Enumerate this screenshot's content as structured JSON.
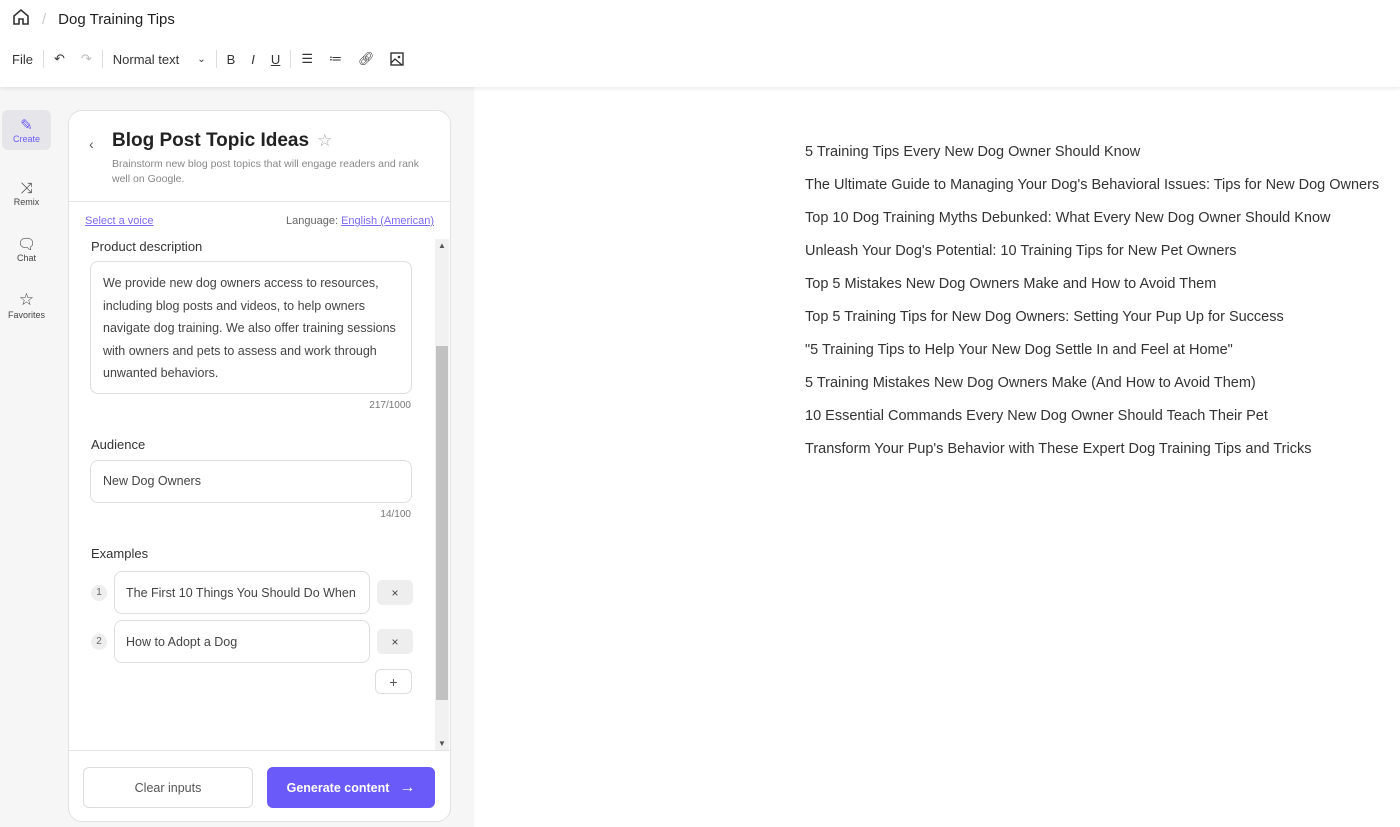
{
  "header": {
    "doc_title": "Dog Training Tips",
    "toolbar": {
      "file": "File",
      "style": "Normal text"
    }
  },
  "nav": [
    {
      "label": "Create"
    },
    {
      "label": "Remix"
    },
    {
      "label": "Chat"
    },
    {
      "label": "Favorites"
    }
  ],
  "panel": {
    "title": "Blog Post Topic Ideas",
    "subtitle": "Brainstorm new blog post topics that will engage readers and rank well on Google.",
    "select_voice": "Select a voice",
    "language_label": "Language:",
    "language": "English (American)",
    "product_label": "Product description",
    "product_value": "We provide new dog owners access to resources, including blog posts and videos, to help owners navigate dog training. We also offer training sessions with owners and pets to assess and work through unwanted behaviors.",
    "product_count": "217/1000",
    "audience_label": "Audience",
    "audience_value": "New Dog Owners",
    "audience_count": "14/100",
    "examples_label": "Examples",
    "examples": [
      {
        "n": "1",
        "value": "The First 10 Things You Should Do When"
      },
      {
        "n": "2",
        "value": "How to Adopt a Dog"
      }
    ],
    "remove": "×",
    "add": "+",
    "clear": "Clear inputs",
    "generate": "Generate content",
    "generate_arrow": "→"
  },
  "results": [
    "5 Training Tips Every New Dog Owner Should Know",
    "The Ultimate Guide to Managing Your Dog's Behavioral Issues: Tips for New Dog Owners",
    "Top 10 Dog Training Myths Debunked: What Every New Dog Owner Should Know",
    "Unleash Your Dog's Potential: 10 Training Tips for New Pet Owners",
    "Top 5 Mistakes New Dog Owners Make and How to Avoid Them",
    "Top 5 Training Tips for New Dog Owners: Setting Your Pup Up for Success",
    "\"5 Training Tips to Help Your New Dog Settle In and Feel at Home\"",
    "5 Training Mistakes New Dog Owners Make (And How to Avoid Them)",
    "10 Essential Commands Every New Dog Owner Should Teach Their Pet",
    "Transform Your Pup's Behavior with These Expert Dog Training Tips and Tricks"
  ],
  "colors": {
    "accent": "#6a5af9"
  }
}
